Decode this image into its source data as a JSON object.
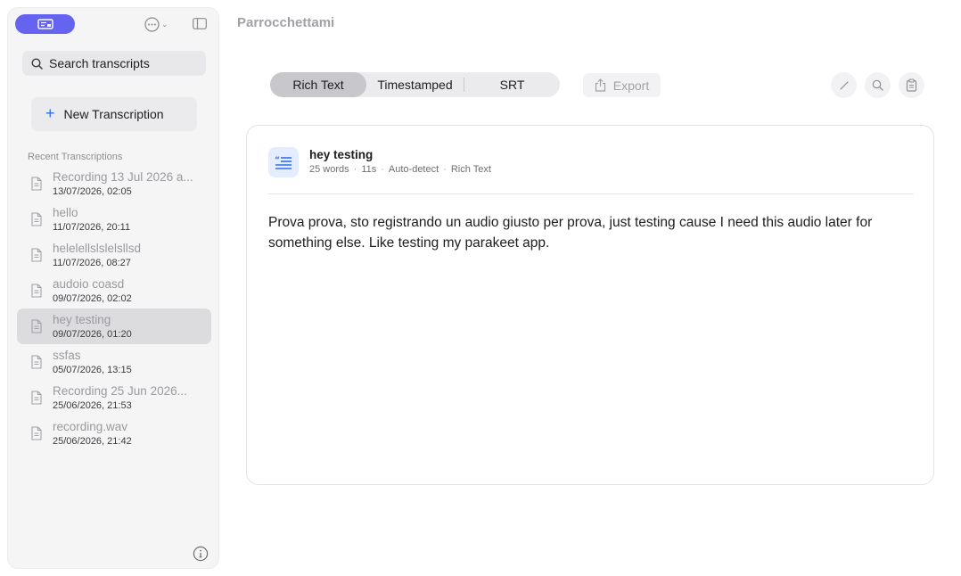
{
  "sidebar": {
    "search_placeholder": "Search transcripts",
    "new_button_label": "New Transcription",
    "section_label": "Recent Transcriptions",
    "items": [
      {
        "title": "Recording 13 Jul 2026 a...",
        "date": "13/07/2026, 02:05",
        "selected": false
      },
      {
        "title": "hello",
        "date": "11/07/2026, 20:11",
        "selected": false
      },
      {
        "title": "helelellslslelsllsd",
        "date": "11/07/2026, 08:27",
        "selected": false
      },
      {
        "title": "audoio coasd",
        "date": "09/07/2026, 02:02",
        "selected": false
      },
      {
        "title": "hey testing",
        "date": "09/07/2026, 01:20",
        "selected": true
      },
      {
        "title": "ssfas",
        "date": "05/07/2026, 13:15",
        "selected": false
      },
      {
        "title": "Recording 25 Jun 2026...",
        "date": "25/06/2026, 21:53",
        "selected": false
      },
      {
        "title": "recording.wav",
        "date": "25/06/2026, 21:42",
        "selected": false
      }
    ]
  },
  "main": {
    "title": "Parrocchettami",
    "tabs": [
      {
        "label": "Rich Text",
        "active": true
      },
      {
        "label": "Timestamped",
        "active": false
      },
      {
        "label": "SRT",
        "active": false
      }
    ],
    "export_label": "Export",
    "transcript": {
      "title": "hey testing",
      "meta": [
        "25 words",
        "11s",
        "Auto-detect",
        "Rich Text"
      ],
      "meta_separator": "·",
      "body": "Prova prova, sto registrando un audio giusto per prova, just testing cause I need this audio later for something else. Like testing my parakeet app."
    }
  },
  "colors": {
    "accent": "#6464f0",
    "link_blue": "#2f6fe6",
    "selected_row": "#dcdcdf",
    "icon_tile": "#e3edfd"
  },
  "icons": [
    "app-switcher-icon",
    "ellipsis-circle-icon",
    "sidebar-toggle-icon",
    "search-icon",
    "plus-icon",
    "document-icon",
    "info-icon",
    "export-icon",
    "pencil-icon",
    "magnifier-icon",
    "copy-icon",
    "quote-list-icon"
  ]
}
